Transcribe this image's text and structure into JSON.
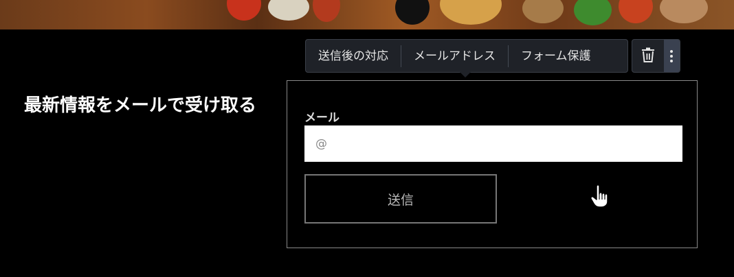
{
  "heading": "最新情報をメールで受け取る",
  "toolbar": {
    "items": [
      "送信後の対応",
      "メールアドレス",
      "フォーム保護"
    ],
    "delete_icon": "trash-icon",
    "more_icon": "more-vertical-icon"
  },
  "form": {
    "email_label": "メール",
    "email_placeholder": "@",
    "submit_label": "送信"
  }
}
